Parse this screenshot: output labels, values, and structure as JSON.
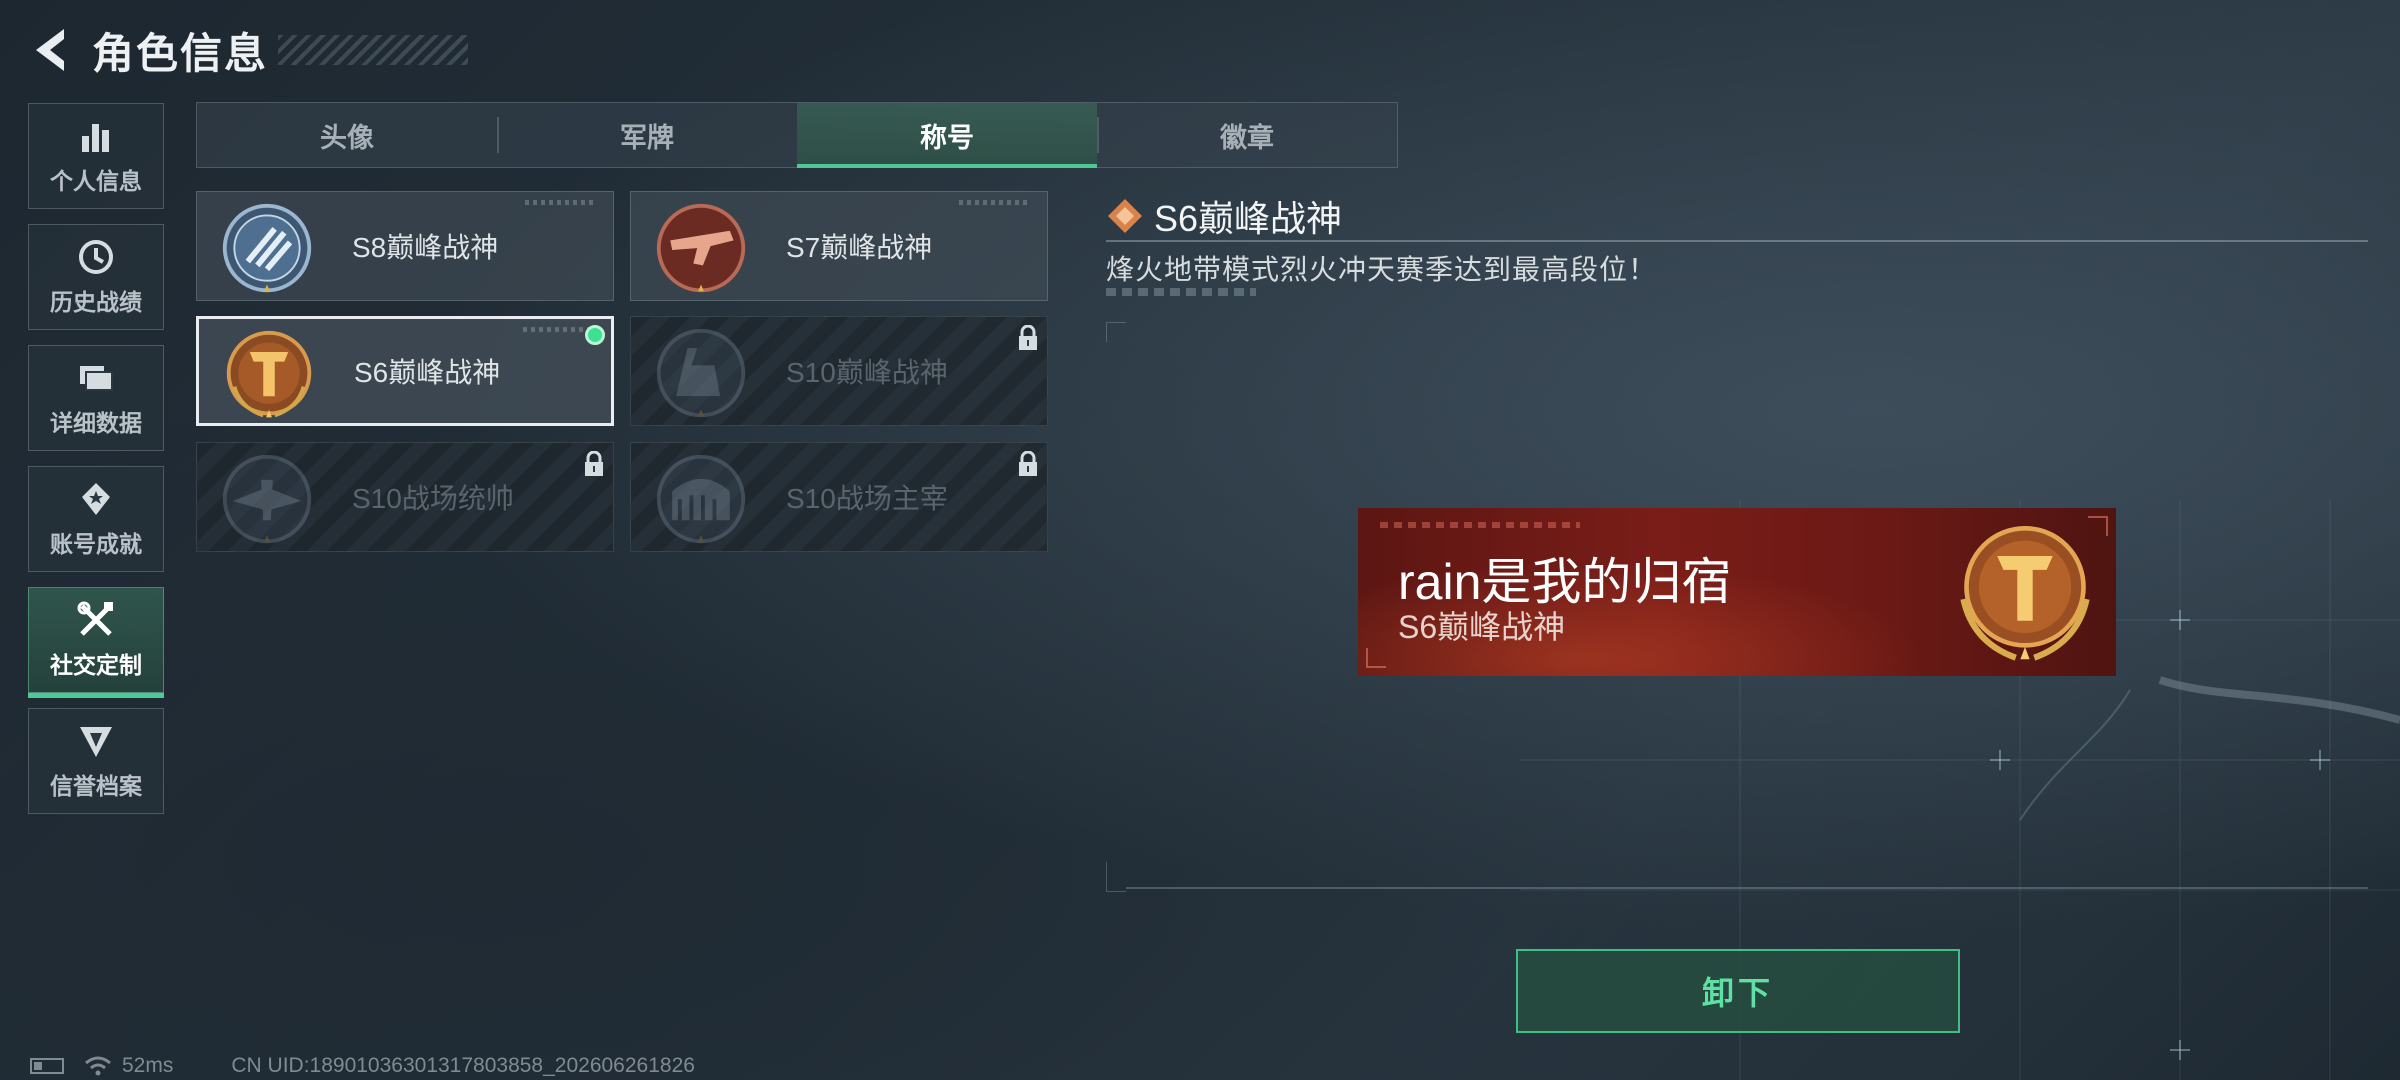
{
  "header": {
    "title": "角色信息"
  },
  "sidebar": {
    "items": [
      {
        "label": "个人信息",
        "icon": "bar-chart-icon"
      },
      {
        "label": "历史战绩",
        "icon": "clock-icon"
      },
      {
        "label": "详细数据",
        "icon": "folder-icon"
      },
      {
        "label": "账号成就",
        "icon": "achievement-icon"
      },
      {
        "label": "社交定制",
        "icon": "tools-icon",
        "active": true
      },
      {
        "label": "信誉档案",
        "icon": "credit-emblem-icon"
      }
    ]
  },
  "tabs": [
    {
      "label": "头像"
    },
    {
      "label": "军牌"
    },
    {
      "label": "称号",
      "active": true
    },
    {
      "label": "徽章"
    }
  ],
  "titles": [
    {
      "name": "S8巅峰战神",
      "locked": false
    },
    {
      "name": "S7巅峰战神",
      "locked": false
    },
    {
      "name": "S6巅峰战神",
      "locked": false,
      "selected": true,
      "equipped": true
    },
    {
      "name": "S10巅峰战神",
      "locked": true
    },
    {
      "name": "S10战场统帅",
      "locked": true
    },
    {
      "name": "S10战场主宰",
      "locked": true
    }
  ],
  "detail": {
    "title": "S6巅峰战神",
    "description": "烽火地带模式烈火冲天赛季达到最高段位！"
  },
  "preview": {
    "player_name": "rain是我的归宿",
    "title": "S6巅峰战神"
  },
  "actions": {
    "unequip_label": "卸下"
  },
  "status_bar": {
    "ping": "52ms",
    "uid": "CN UID:18901036301317803858_202606261826"
  },
  "colors": {
    "accent": "#4ec995",
    "banner": "#7a1d18",
    "badge_gold": "#c98a3c"
  }
}
